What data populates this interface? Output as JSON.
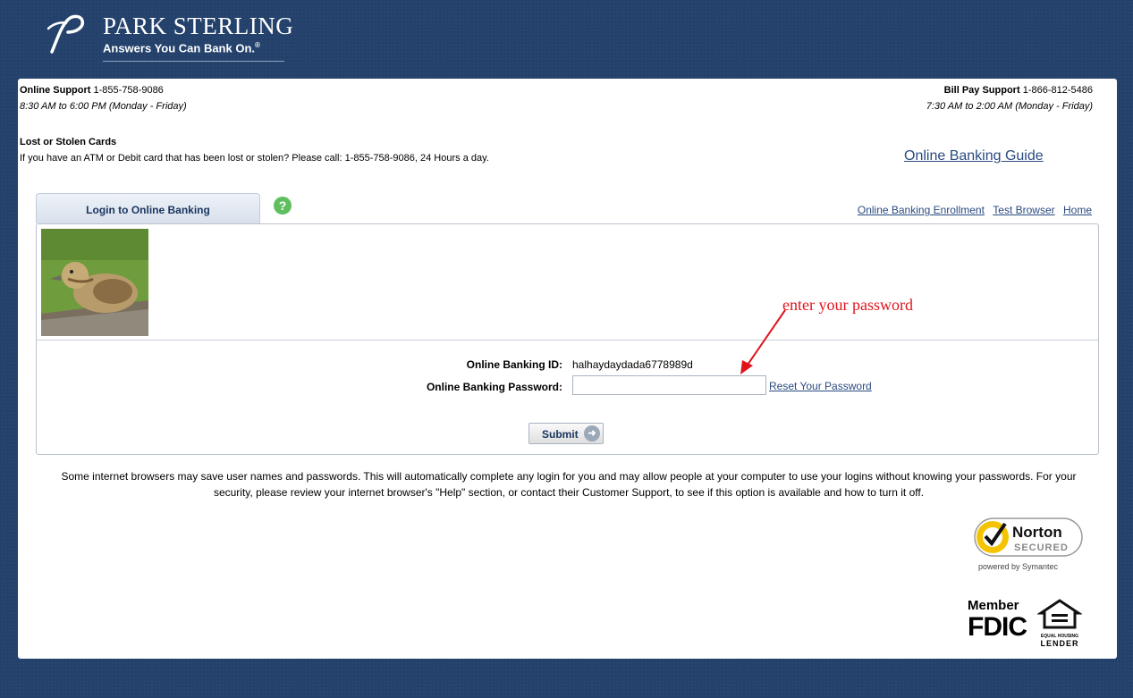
{
  "brand": {
    "name": "PARK STERLING",
    "tagline": "Answers You Can Bank On.",
    "tagline_mark": "®"
  },
  "support": {
    "online_label": "Online Support",
    "online_phone": "1-855-758-9086",
    "online_hours": "8:30 AM to 6:00 PM (Monday - Friday)",
    "billpay_label": "Bill Pay Support",
    "billpay_phone": "1-866-812-5486",
    "billpay_hours": "7:30 AM to 2:00 AM (Monday - Friday)"
  },
  "lost_cards": {
    "title": "Lost or Stolen Cards",
    "text": "If you have an ATM or Debit card that has been lost or stolen? Please call: 1-855-758-9086, 24 Hours a day."
  },
  "guide_link": "Online Banking Guide",
  "login_tab": "Login to Online Banking",
  "help_icon": "?",
  "top_links": [
    "Online Banking Enrollment",
    "Test Browser",
    "Home"
  ],
  "form": {
    "id_label": "Online Banking ID:",
    "id_value": "halhaydaydada6778989d",
    "password_label": "Online Banking Password:",
    "password_value": "",
    "reset_link": "Reset Your Password",
    "submit_label": "Submit"
  },
  "annotation": "enter your password",
  "notice": "Some internet browsers may save user names and passwords. This will automatically complete any login for you and may allow people at your computer to use your logins without knowing your passwords. For your security, please review your internet browser's \"Help\" section, or contact their Customer Support, to see if this option is available and how to turn it off.",
  "badges": {
    "norton_name": "Norton",
    "norton_secured": "SECURED",
    "norton_powered": "powered by Symantec",
    "fdic_member": "Member",
    "fdic": "FDIC",
    "ehl_line1": "EQUAL HOUSING",
    "ehl_line2": "LENDER"
  },
  "colors": {
    "background": "#23416b",
    "link": "#2a4a80",
    "annotation": "#e0141c"
  }
}
